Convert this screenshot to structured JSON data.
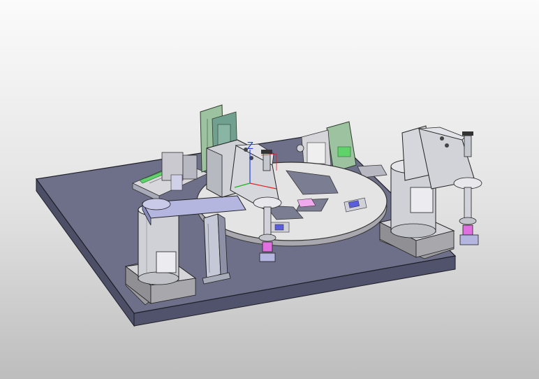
{
  "axis_triad": {
    "z_label": "Z",
    "colors": {
      "x": "#e02020",
      "y": "#20b020",
      "z": "#2040e0"
    }
  },
  "colors": {
    "background_top": "#fbfbfb",
    "background_bottom": "#bdbdbd",
    "base_top": "#6d7088",
    "base_side": "#4c4f66",
    "robot_body": "#cfd1d6",
    "robot_arm": "#b4b6e0",
    "tool_accent": "#e070e0",
    "fixture_green": "#9cc2a0",
    "turntable": "#e4e4e4"
  },
  "parts": [
    {
      "name": "scara-robot-left",
      "icon": "scara-robot-icon"
    },
    {
      "name": "scara-robot-center",
      "icon": "scara-robot-icon"
    },
    {
      "name": "scara-robot-right",
      "icon": "scara-robot-icon"
    },
    {
      "name": "rotary-turntable",
      "icon": "turntable-icon"
    },
    {
      "name": "conveyor-feeder",
      "icon": "conveyor-icon"
    },
    {
      "name": "vision-station",
      "icon": "camera-icon"
    },
    {
      "name": "support-column",
      "icon": "column-icon"
    }
  ]
}
